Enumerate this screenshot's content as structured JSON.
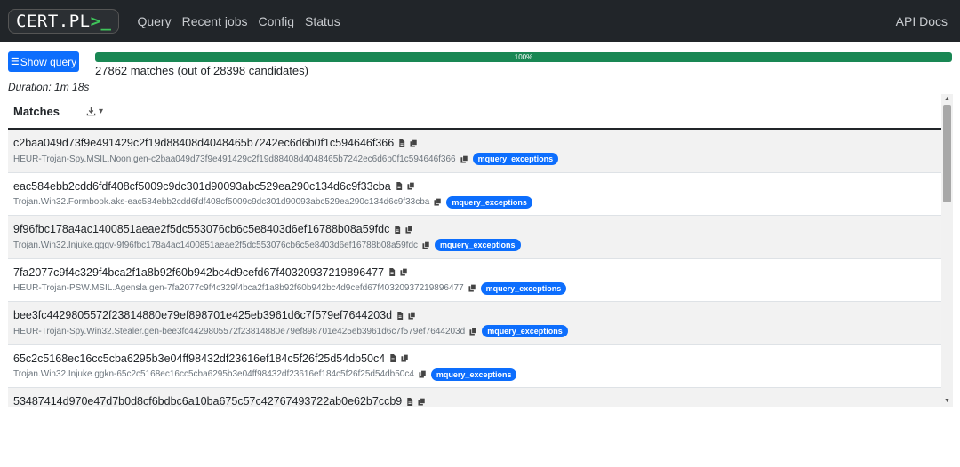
{
  "nav": {
    "logo_text": "CERT.PL",
    "logo_prompt": ">_",
    "links": [
      "Query",
      "Recent jobs",
      "Config",
      "Status"
    ],
    "right_link": "API Docs"
  },
  "status": {
    "show_query_label": "Show query",
    "progress_label": "100%",
    "progress_value": 100,
    "matches_summary": "27862 matches (out of 28398 candidates)",
    "duration": "Duration: 1m 18s"
  },
  "table": {
    "header": "Matches",
    "badge_label": "mquery_exceptions",
    "rows": [
      {
        "hash": "c2baa049d73f9e491429c2f19d88408d4048465b7242ec6d6b0f1c594646f366",
        "detection": "HEUR-Trojan-Spy.MSIL.Noon.gen-c2baa049d73f9e491429c2f19d88408d4048465b7242ec6d6b0f1c594646f366"
      },
      {
        "hash": "eac584ebb2cdd6fdf408cf5009c9dc301d90093abc529ea290c134d6c9f33cba",
        "detection": "Trojan.Win32.Formbook.aks-eac584ebb2cdd6fdf408cf5009c9dc301d90093abc529ea290c134d6c9f33cba"
      },
      {
        "hash": "9f96fbc178a4ac1400851aeae2f5dc553076cb6c5e8403d6ef16788b08a59fdc",
        "detection": "Trojan.Win32.Injuke.gggv-9f96fbc178a4ac1400851aeae2f5dc553076cb6c5e8403d6ef16788b08a59fdc"
      },
      {
        "hash": "7fa2077c9f4c329f4bca2f1a8b92f60b942bc4d9cefd67f40320937219896477",
        "detection": "HEUR-Trojan-PSW.MSIL.Agensla.gen-7fa2077c9f4c329f4bca2f1a8b92f60b942bc4d9cefd67f40320937219896477"
      },
      {
        "hash": "bee3fc4429805572f23814880e79ef898701e425eb3961d6c7f579ef7644203d",
        "detection": "HEUR-Trojan-Spy.Win32.Stealer.gen-bee3fc4429805572f23814880e79ef898701e425eb3961d6c7f579ef7644203d"
      },
      {
        "hash": "65c2c5168ec16cc5cba6295b3e04ff98432df23616ef184c5f26f25d54db50c4",
        "detection": "Trojan.Win32.Injuke.ggkn-65c2c5168ec16cc5cba6295b3e04ff98432df23616ef184c5f26f25d54db50c4"
      },
      {
        "hash": "53487414d970e47d7b0d8cf6bdbc6a10ba675c57c42767493722ab0e62b7ccb9",
        "detection": ""
      }
    ]
  }
}
